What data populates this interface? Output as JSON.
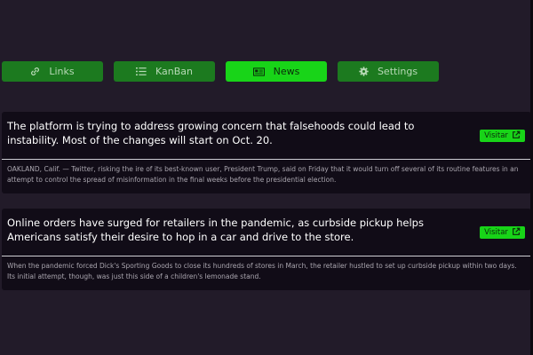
{
  "nav": {
    "items": [
      {
        "label": "Links",
        "icon": "link-icon",
        "active": false
      },
      {
        "label": "KanBan",
        "icon": "list-icon",
        "active": false
      },
      {
        "label": "News",
        "icon": "newspaper-icon",
        "active": true
      },
      {
        "label": "Settings",
        "icon": "gear-icon",
        "active": false
      }
    ]
  },
  "articles": [
    {
      "headline": "The platform is trying to address growing concern that falsehoods could lead to instability. Most of the changes will start on Oct. 20.",
      "summary": "OAKLAND, Calif. — Twitter, risking the ire of its best-known user, President Trump, said on Friday that it would turn off several of its routine features in an attempt to control the spread of misinformation in the final weeks before the presidential election.",
      "visit_label": "Visitar"
    },
    {
      "headline": "Online orders have surged for retailers in the pandemic, as curbside pickup helps Americans satisfy their desire to hop in a car and drive to the store.",
      "summary": "When the pandemic forced Dick's Sporting Goods to close its hundreds of stores in March, the retailer hustled to set up curbside pickup within two days. Its initial attempt, though, was just this side of a children's lemonade stand.",
      "visit_label": "Visitar"
    }
  ],
  "colors": {
    "background": "#221b29",
    "card": "#110c17",
    "nav_button": "#1c7a1f",
    "nav_button_active": "#18d418",
    "accent": "#18d418"
  }
}
